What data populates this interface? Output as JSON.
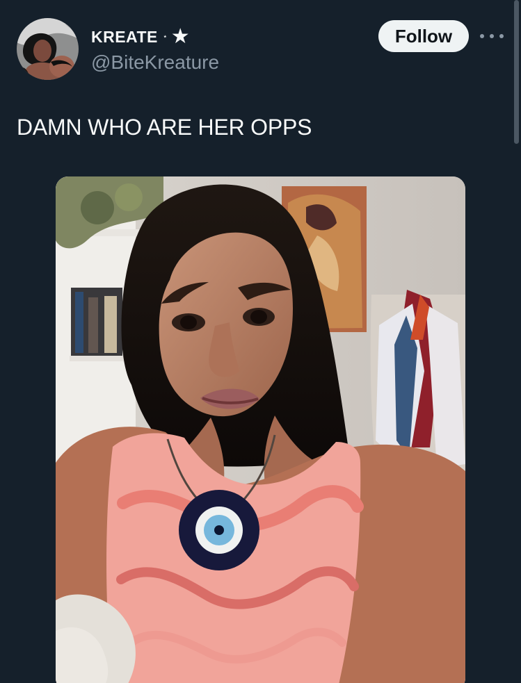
{
  "post": {
    "author": {
      "display_name": "KREATE",
      "name_decoration": "⋆",
      "badge": "★",
      "handle": "@BiteKreature",
      "avatar_icon": "profile-photo"
    },
    "follow_label": "Follow",
    "more_icon": "more-dots-icon",
    "text": "DAMN WHO ARE HER OPPS",
    "media_icon": "photo"
  },
  "colors": {
    "background": "#15202b",
    "primary_text": "#f7f9f9",
    "secondary_text": "#8b98a5",
    "follow_bg": "#eff3f4"
  }
}
